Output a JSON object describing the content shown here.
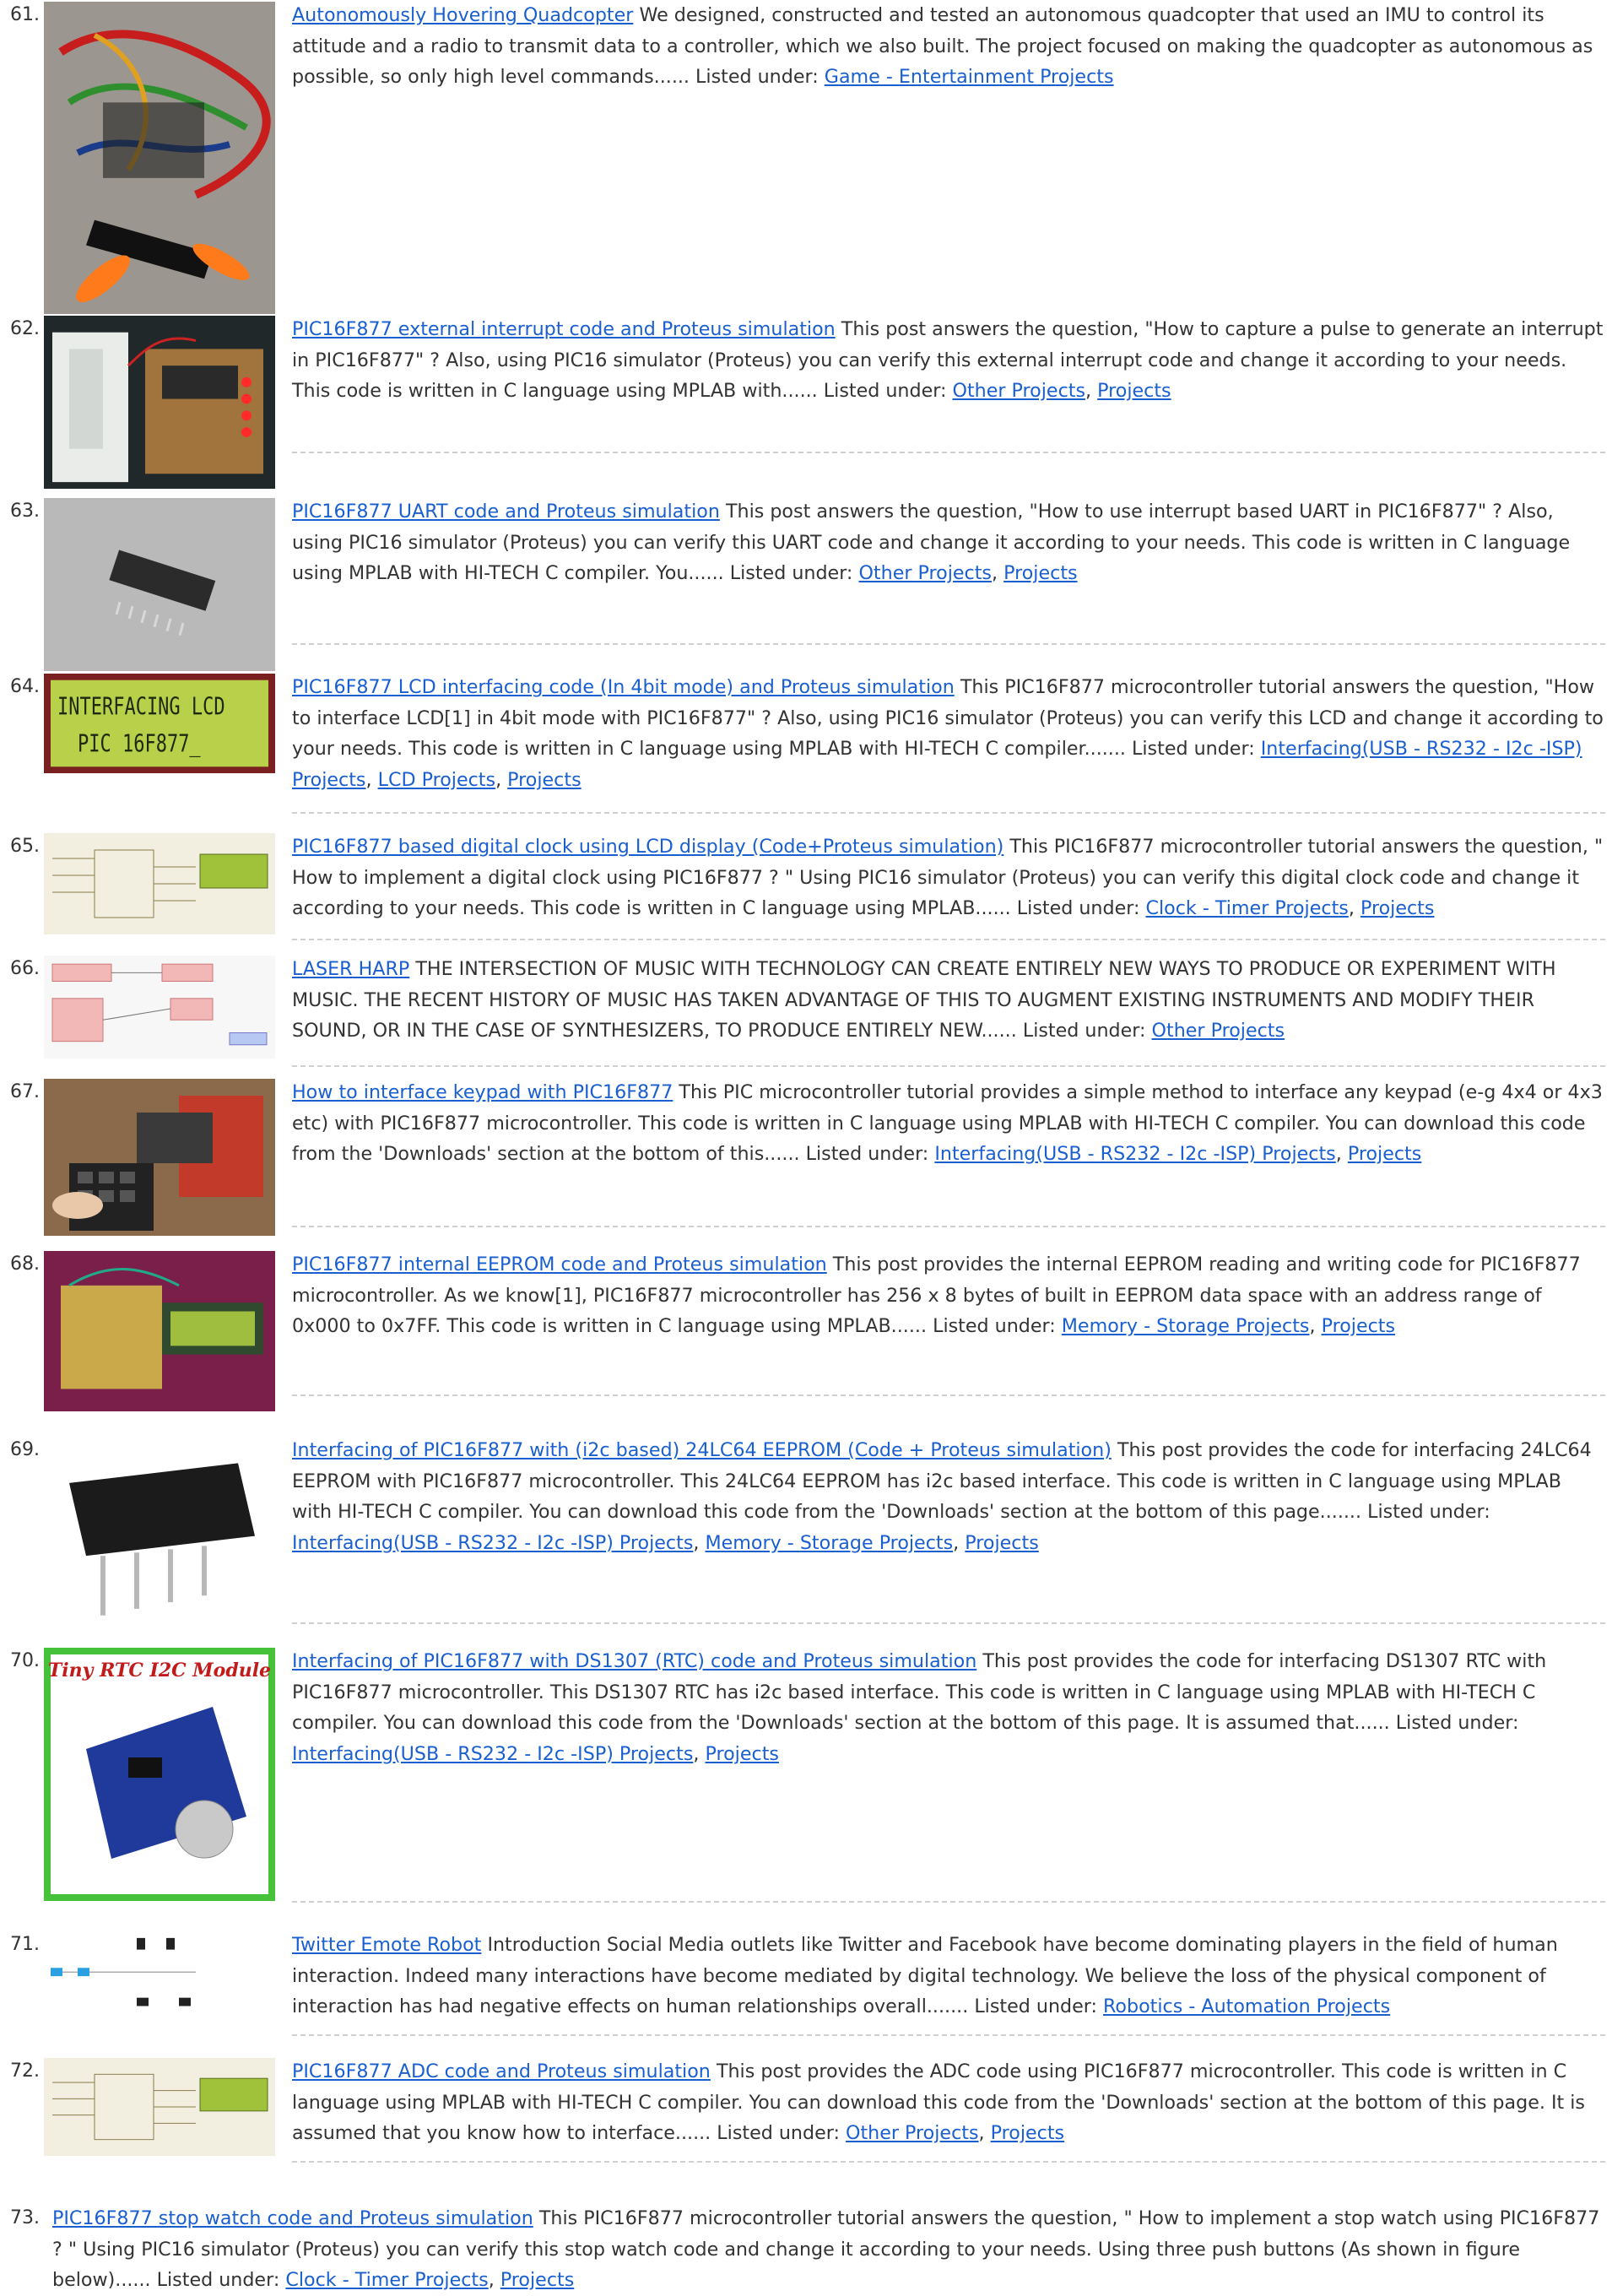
{
  "listed_under_label": "Listed under:",
  "items": [
    {
      "num": "61.",
      "title": "Autonomously Hovering Quadcopter",
      "desc": "We designed, constructed and tested an autonomous quadcopter that used an IMU to control its attitude and a radio to transmit data to a controller, which we also built. The project focused on making the quadcopter as autonomous as possible, so only high level commands......",
      "cats": [
        "Game - Entertainment Projects"
      ],
      "image": "quadcopter-photo"
    },
    {
      "num": "62.",
      "title": "PIC16F877 external interrupt code and Proteus simulation",
      "desc": "This post answers the question, \"How to capture a pulse to generate an interrupt in PIC16F877\" ? Also, using PIC16 simulator (Proteus) you can verify this external interrupt code and change it according to your needs. This code is written in C language using MPLAB with......",
      "cats": [
        "Other Projects",
        "Projects"
      ],
      "image": "breadboard-photo"
    },
    {
      "num": "63.",
      "title": "PIC16F877 UART code and Proteus simulation",
      "desc": "This post answers the question, \"How to use interrupt based UART in PIC16F877\" ? Also, using PIC16 simulator (Proteus) you can verify this UART code and change it according to your needs. This code is written in C language using MPLAB with HI-TECH C compiler. You......",
      "cats": [
        "Other Projects",
        "Projects"
      ],
      "image": "ic-chip-photo"
    },
    {
      "num": "64.",
      "title": "PIC16F877 LCD interfacing code (In 4bit mode) and Proteus simulation",
      "desc": "This PIC16F877 microcontroller tutorial answers the question, \"How to interface LCD[1]  in 4bit mode with PIC16F877\" ? Also, using PIC16 simulator (Proteus) you can verify this LCD and change it according to your needs. This code is written in C language using MPLAB with HI-TECH C compiler.......",
      "cats": [
        "Interfacing(USB - RS232 - I2c -ISP) Projects",
        "LCD Projects",
        "Projects"
      ],
      "image": "lcd-display",
      "lcd_line1": "INTERFACING LCD",
      "lcd_line2": "PIC 16F877_"
    },
    {
      "num": "65.",
      "title": "PIC16F877 based digital clock using LCD display (Code+Proteus simulation)",
      "desc": "This PIC16F877 microcontroller tutorial answers the question, \" How to implement a digital clock using PIC16F877 ? \"   Using PIC16 simulator (Proteus) you can verify this digital clock code and change it according to your needs. This code is written in C language using MPLAB......",
      "cats": [
        "Clock - Timer Projects",
        "Projects"
      ],
      "image": "schematic"
    },
    {
      "num": "66.",
      "title": "LASER HARP",
      "desc": "THE INTERSECTION OF MUSIC WITH TECHNOLOGY CAN CREATE ENTIRELY NEW WAYS TO PRODUCE OR EXPERIMENT WITH MUSIC. THE RECENT HISTORY OF MUSIC HAS TAKEN ADVANTAGE OF THIS TO AUGMENT EXISTING INSTRUMENTS AND MODIFY THEIR SOUND, OR IN THE CASE OF SYNTHESIZERS, TO PRODUCE ENTIRELY NEW......",
      "cats": [
        "Other Projects"
      ],
      "image": "block-diagram"
    },
    {
      "num": "67.",
      "title": "How to interface keypad with PIC16F877",
      "desc": "This PIC microcontroller tutorial provides a simple method to interface any keypad (e-g 4x4 or 4x3 etc) with PIC16F877 microcontroller. This code is written in C language using MPLAB with HI-TECH C compiler. You can download this code from the 'Downloads' section at the bottom of this......",
      "cats": [
        "Interfacing(USB - RS232 - I2c -ISP) Projects",
        "Projects"
      ],
      "image": "keypad-photo"
    },
    {
      "num": "68.",
      "title": "PIC16F877 internal EEPROM code and Proteus simulation",
      "desc": "This post provides the internal EEPROM reading and writing code for PIC16F877 microcontroller. As we know[1], PIC16F877 microcontroller has 256 x 8 bytes of built in EEPROM data space with an address range of 0x000 to 0x7FF. This code is written in C language using MPLAB......",
      "cats": [
        "Memory - Storage Projects",
        "Projects"
      ],
      "image": "eeprom-board-photo"
    },
    {
      "num": "69.",
      "title": "Interfacing of PIC16F877 with (i2c based) 24LC64 EEPROM (Code + Proteus simulation)",
      "desc": "This post provides the code for interfacing 24LC64 EEPROM with PIC16F877 microcontroller. This 24LC64 EEPROM has i2c based interface. This code is written in C language using MPLAB with HI-TECH C compiler. You can download this code from the 'Downloads' section at the bottom of this page.......",
      "cats": [
        "Interfacing(USB - RS232 - I2c -ISP) Projects",
        "Memory - Storage Projects",
        "Projects"
      ],
      "image": "dip8-chip"
    },
    {
      "num": "70.",
      "title": "Interfacing of PIC16F877 with DS1307 (RTC) code and Proteus simulation",
      "desc": "This post provides the code for interfacing DS1307 RTC with PIC16F877 microcontroller. This DS1307 RTC has i2c based interface. This code is written in C language using MPLAB with HI-TECH C compiler. You can download this code from the 'Downloads' section at the bottom of this page. It is assumed that......",
      "cats": [
        "Interfacing(USB - RS232 - I2c -ISP) Projects",
        "Projects"
      ],
      "image": "rtc-module",
      "rtc_label": "Tiny RTC I2C Module"
    },
    {
      "num": "71.",
      "title": "Twitter Emote Robot",
      "desc": "Introduction Social Media outlets like Twitter and Facebook have become dominating players in the field of human interaction. Indeed many interactions have become mediated by digital technology. We believe the loss of the physical component of interaction has had negative effects on human relationships overall.......",
      "cats": [
        "Robotics - Automation Projects"
      ],
      "image": "robot-diagram"
    },
    {
      "num": "72.",
      "title": "PIC16F877 ADC code and Proteus simulation",
      "desc": "This post provides the ADC code using PIC16F877 microcontroller. This code is written in C language using MPLAB with HI-TECH C compiler. You can download this code from the 'Downloads' section at the bottom of this page.   It is assumed that you know how to interface......",
      "cats": [
        "Other Projects",
        "Projects"
      ],
      "image": "schematic"
    },
    {
      "num": "73.",
      "title": "PIC16F877 stop watch code and Proteus simulation",
      "desc": "This PIC16F877 microcontroller tutorial answers the question, \" How to implement a stop watch using PIC16F877 ? \" Using PIC16 simulator (Proteus) you can verify this stop watch code and change it according to your needs. Using three push buttons (As shown in figure below)......",
      "cats": [
        "Clock - Timer Projects",
        "Projects"
      ],
      "image": ""
    }
  ]
}
